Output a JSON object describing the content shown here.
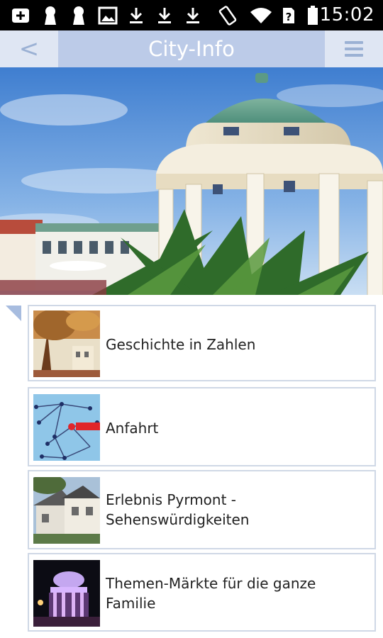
{
  "status_bar": {
    "time": "15:02",
    "icons": [
      "add-box-icon",
      "keyhole-icon",
      "keyhole-icon",
      "image-icon",
      "download-icon",
      "download-icon",
      "download-icon",
      "rotate-icon",
      "wifi-icon",
      "unknown-sim-icon",
      "battery-icon"
    ]
  },
  "header": {
    "back_glyph": "<",
    "title": "City-Info",
    "menu_icon": "hamburger-menu-icon"
  },
  "hero": {
    "image": "photo of domed spa pavilion with palm plants"
  },
  "list": {
    "items": [
      {
        "label_line1": "Geschichte in Zahlen",
        "label_line2": "",
        "thumb": "tree-and-building-photo"
      },
      {
        "label_line1": "Anfahrt",
        "label_line2": "",
        "thumb": "route-map-thumbnail"
      },
      {
        "label_line1": "Erlebnis Pyrmont -",
        "label_line2": "Sehenswürdigkeiten",
        "thumb": "house-photo"
      },
      {
        "label_line1": "Themen-Märkte für die ganze",
        "label_line2": "Familie",
        "thumb": "illuminated-pavilion-photo"
      }
    ]
  },
  "colors": {
    "header_title_bg": "#bccbe8",
    "header_side_bg": "#dfe6f3",
    "header_icon": "#9bb1d4",
    "item_border": "#cfd8e6"
  }
}
